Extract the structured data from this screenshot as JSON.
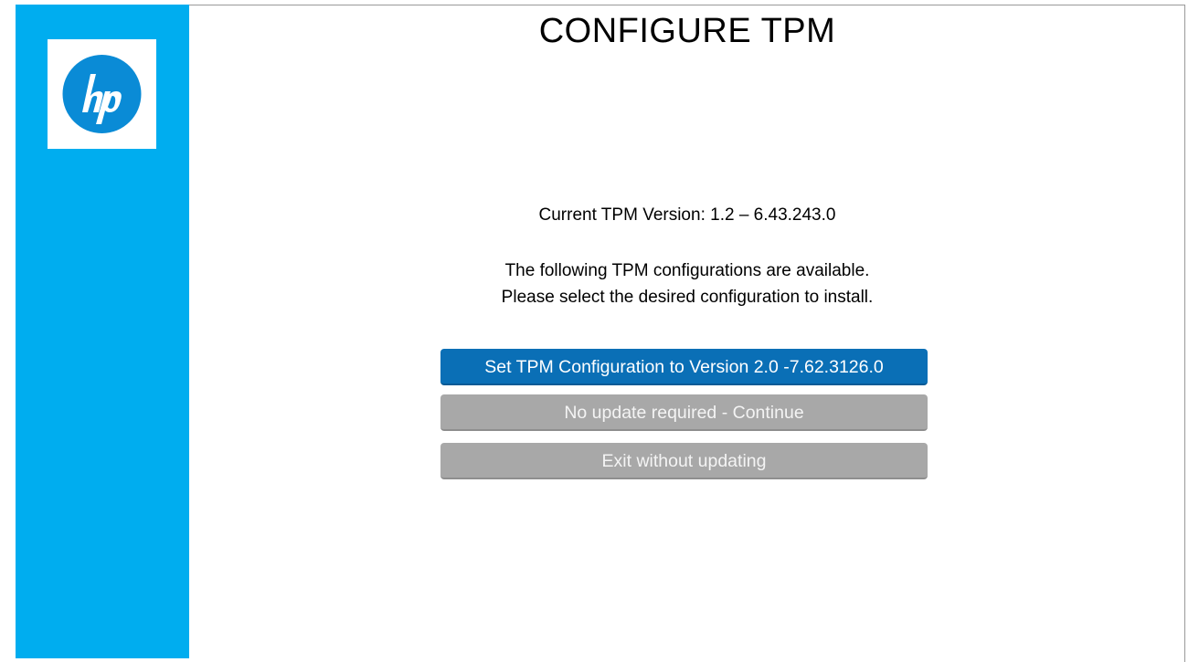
{
  "title": "CONFIGURE TPM",
  "current_version_text": "Current TPM Version: 1.2 – 6.43.243.0",
  "instructions": {
    "line1": "The following TPM configurations are available.",
    "line2": "Please select the desired configuration to install."
  },
  "buttons": {
    "set_config": "Set TPM Configuration to Version 2.0 -7.62.3126.0",
    "no_update": "No update required - Continue",
    "exit": "Exit without updating"
  },
  "logo": {
    "text": "hp",
    "icon": "hp-logo-icon"
  },
  "colors": {
    "sidebar": "#00adef",
    "primary_button": "#0a6fb6",
    "secondary_button": "#a8a8a8"
  }
}
